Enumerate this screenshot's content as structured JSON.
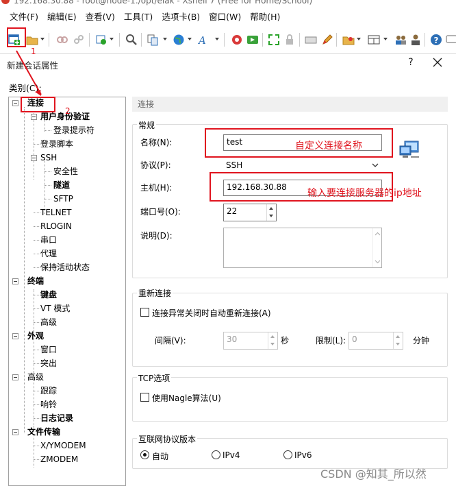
{
  "window": {
    "title": "192.168.30.88 - root@node-1:/opt/elak - Xshell 7 (Free for Home/School)"
  },
  "menu": [
    "文件(F)",
    "编辑(E)",
    "查看(V)",
    "工具(T)",
    "选项卡(B)",
    "窗口(W)",
    "帮助(H)"
  ],
  "toolbar_icons": [
    "new-session-icon",
    "open-folder-icon",
    "connect-icon",
    "disconnect-icon",
    "properties-icon",
    "find-icon",
    "copy-icon",
    "globe-icon",
    "font-icon",
    "xftp-icon",
    "green-icon",
    "fullscreen-icon",
    "lock-icon",
    "keyboard-icon",
    "pencil-icon",
    "folder-icon",
    "layout-icon",
    "users-icon",
    "user-icon",
    "help-icon",
    "chat-icon"
  ],
  "dialog": {
    "title": "新建会话属性",
    "help": "?",
    "category_label": "类别(C):",
    "tree": [
      {
        "label": "连接",
        "bold": true
      },
      {
        "label": "用户身份验证",
        "bold": true
      },
      {
        "label": "登录提示符"
      },
      {
        "label": "登录脚本"
      },
      {
        "label": "SSH"
      },
      {
        "label": "安全性"
      },
      {
        "label": "隧道",
        "bold": true
      },
      {
        "label": "SFTP"
      },
      {
        "label": "TELNET"
      },
      {
        "label": "RLOGIN"
      },
      {
        "label": "串口"
      },
      {
        "label": "代理"
      },
      {
        "label": "保持活动状态"
      },
      {
        "label": "终端",
        "bold": true
      },
      {
        "label": "键盘",
        "bold": true
      },
      {
        "label": "VT 模式"
      },
      {
        "label": "高级"
      },
      {
        "label": "外观",
        "bold": true
      },
      {
        "label": "窗口"
      },
      {
        "label": "突出"
      },
      {
        "label": "高级"
      },
      {
        "label": "跟踪"
      },
      {
        "label": "响铃"
      },
      {
        "label": "日志记录",
        "bold": true
      },
      {
        "label": "文件传输",
        "bold": true
      },
      {
        "label": "X/YMODEM"
      },
      {
        "label": "ZMODEM"
      }
    ],
    "panel_header": "连接",
    "general": {
      "group": "常规",
      "name_label": "名称(N):",
      "name_value": "test",
      "protocol_label": "协议(P):",
      "protocol_value": "SSH",
      "host_label": "主机(H):",
      "host_value": "192.168.30.88",
      "port_label": "端口号(O):",
      "port_value": "22",
      "desc_label": "说明(D):"
    },
    "reconnect": {
      "group": "重新连接",
      "checkbox_label": "连接异常关闭时自动重新连接(A)",
      "interval_label": "间隔(V):",
      "interval_value": "30",
      "interval_unit": "秒",
      "limit_label": "限制(L):",
      "limit_value": "0",
      "limit_unit": "分钟"
    },
    "tcp": {
      "group": "TCP选项",
      "nagle_label": "使用Nagle算法(U)"
    },
    "ip": {
      "group": "互联网协议版本",
      "options": [
        "自动",
        "IPv4",
        "IPv6"
      ],
      "selected": "自动"
    }
  },
  "annotations": {
    "step1": "1",
    "step2": "2",
    "name_hint": "自定义连接名称",
    "host_hint": "输入要连接服务器的ip地址"
  },
  "watermark": "CSDN @知其_所以然",
  "colors": {
    "annotation": "#e0141e",
    "panel_header_bg": "#f0f0f0"
  }
}
